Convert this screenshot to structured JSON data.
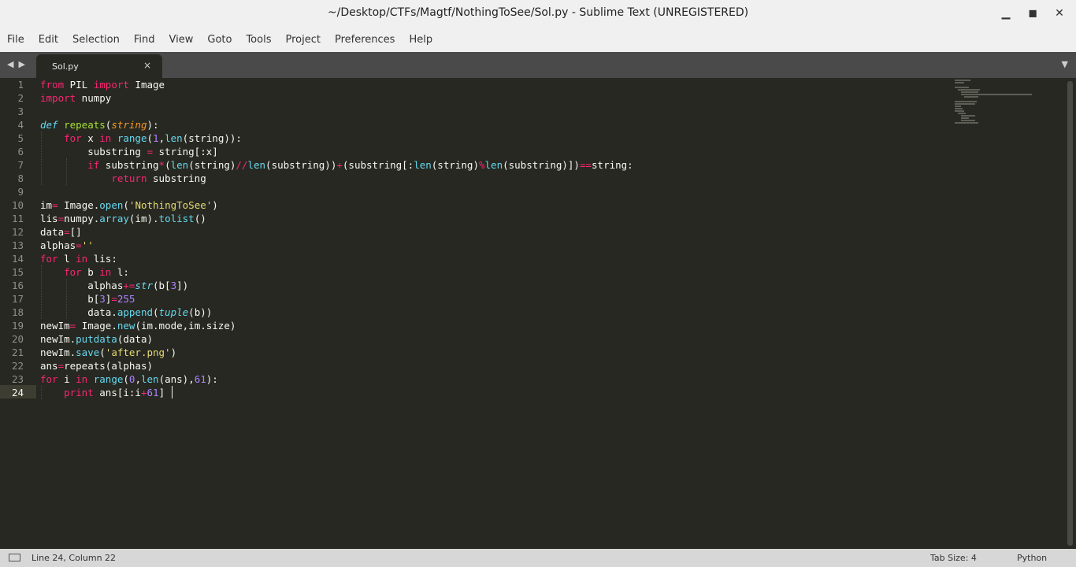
{
  "window": {
    "title": "~/Desktop/CTFs/Magtf/NothingToSee/Sol.py - Sublime Text (UNREGISTERED)",
    "controls": [
      "minimize",
      "maximize",
      "close"
    ]
  },
  "menu": [
    "File",
    "Edit",
    "Selection",
    "Find",
    "View",
    "Goto",
    "Tools",
    "Project",
    "Preferences",
    "Help"
  ],
  "tab": {
    "label": "Sol.py",
    "close_glyph": "×"
  },
  "line_numbers": [
    "1",
    "2",
    "3",
    "4",
    "5",
    "6",
    "7",
    "8",
    "9",
    "10",
    "11",
    "12",
    "13",
    "14",
    "15",
    "16",
    "17",
    "18",
    "19",
    "20",
    "21",
    "22",
    "23",
    "24"
  ],
  "code_lines": [
    "from PIL import Image",
    "import numpy",
    "",
    "def repeats(string):",
    "    for x in range(1,len(string)):",
    "        substring = string[:x]",
    "        if substring*(len(string)//len(substring))+(substring[:len(string)%len(substring)])==string:",
    "            return substring",
    "",
    "im= Image.open('NothingToSee')",
    "lis=numpy.array(im).tolist()",
    "data=[]",
    "alphas=''",
    "for l in lis:",
    "    for b in l:",
    "        alphas+=str(b[3])",
    "        b[3]=255",
    "        data.append(tuple(b))",
    "newIm= Image.new(im.mode,im.size)",
    "newIm.putdata(data)",
    "newIm.save('after.png')",
    "ans=repeats(alphas)",
    "for i in range(0,len(ans),61):",
    "    print ans[i:i+61]"
  ],
  "status": {
    "position": "Line 24, Column 22",
    "tab_size": "Tab Size: 4",
    "syntax": "Python"
  }
}
